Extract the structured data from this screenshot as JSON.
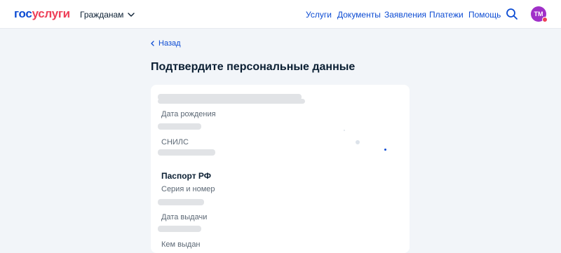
{
  "header": {
    "logo_part1": "гос",
    "logo_part2": "услуги",
    "citizens_label": "Гражданам",
    "nav": [
      "Услуги",
      "Документы",
      "Заявления",
      "Платежи",
      "Помощь"
    ],
    "avatar_initials": "ТМ"
  },
  "main": {
    "back_label": "Назад",
    "title": "Подтвердите персональные данные",
    "fields": {
      "birth_date": "Дата рождения",
      "snils": "СНИЛС",
      "passport_title": "Паспорт РФ",
      "series_number": "Серия и номер",
      "issue_date": "Дата выдачи",
      "issued_by": "Кем выдан"
    }
  },
  "colors": {
    "brand_blue": "#0d4cd3",
    "brand_red": "#ee3f58",
    "avatar": "#a030c8"
  },
  "icons": [
    "chevron-down-icon",
    "search-icon",
    "chevron-left-icon"
  ]
}
